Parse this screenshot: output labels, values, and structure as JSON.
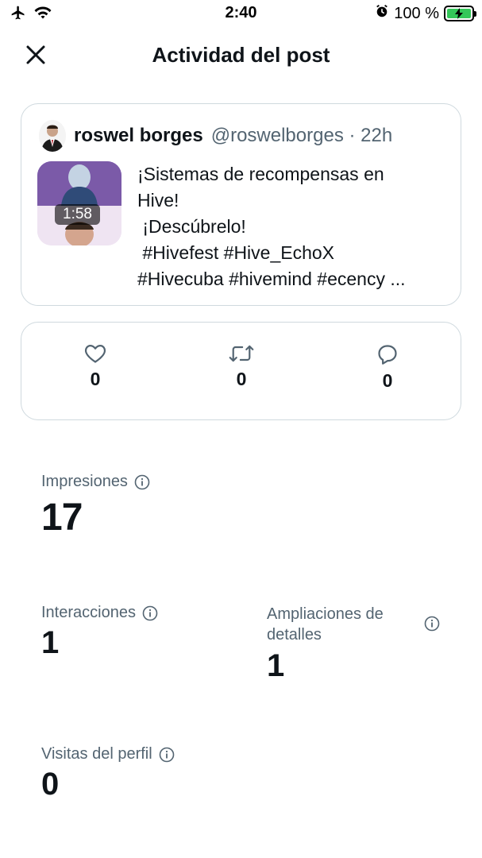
{
  "status_bar": {
    "time": "2:40",
    "battery": "100 %",
    "icons": [
      "airplane-icon",
      "wifi-icon",
      "alarm-icon",
      "battery-charging-icon"
    ]
  },
  "header": {
    "title": "Actividad del post",
    "close_icon": "close-icon"
  },
  "post": {
    "author_name": "roswel borges",
    "author_handle": "@roswelborges · 22h",
    "video_duration": "1:58",
    "text_lines": [
      "¡Sistemas de recompensas en",
      "Hive!",
      " ¡Descúbrelo!",
      " #Hivefest #Hive_EchoX",
      "#Hivecuba #hivemind #ecency ..."
    ]
  },
  "engagement": {
    "likes": "0",
    "reposts": "0",
    "replies": "0"
  },
  "metrics": {
    "impressions_label": "Impresiones",
    "impressions_value": "17",
    "interactions_label": "Interacciones",
    "interactions_value": "1",
    "expansions_label_line1": "Ampliaciones de",
    "expansions_label_line2": "detalles",
    "expansions_value": "1",
    "profile_visits_label": "Visitas del perfil",
    "profile_visits_value": "0"
  },
  "colors": {
    "text_primary": "#0f1419",
    "text_secondary": "#536471",
    "border": "#cfd9de",
    "battery_green": "#34c759"
  }
}
